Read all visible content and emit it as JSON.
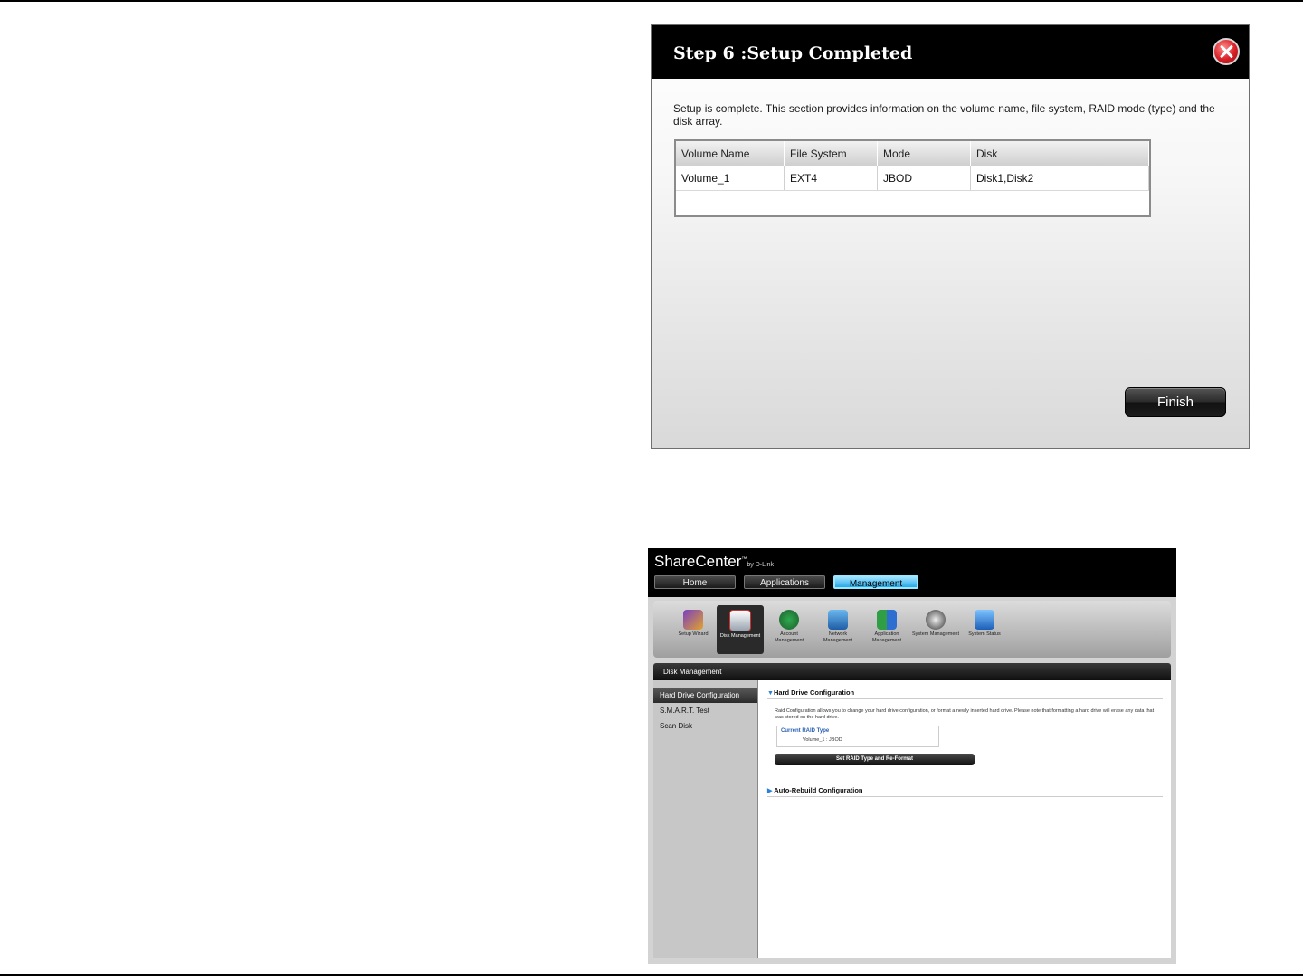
{
  "dialog": {
    "title": "Step 6 :Setup Completed",
    "description": "Setup is complete. This section provides information on the volume name, file system, RAID mode (type) and the disk array.",
    "table": {
      "headers": [
        "Volume Name",
        "File System",
        "Mode",
        "Disk"
      ],
      "rows": [
        [
          "Volume_1",
          "EXT4",
          "JBOD",
          "Disk1,Disk2"
        ]
      ]
    },
    "finish_label": "Finish"
  },
  "sharecenter": {
    "logo": "ShareCenter",
    "logo_tm": "™",
    "logo_by": "by D-Link",
    "tabs": [
      "Home",
      "Applications",
      "Management"
    ],
    "toolbar": [
      "Setup Wizard",
      "Disk Management",
      "Account Management",
      "Network Management",
      "Application Management",
      "System Management",
      "System Status"
    ],
    "panel_title": "Disk Management",
    "side_items": [
      "Hard Drive Configuration",
      "S.M.A.R.T. Test",
      "Scan Disk"
    ],
    "section1_title": "Hard Drive Configuration",
    "section1_desc": "Raid Configuration allows you to change your hard drive configuration, or format a newly inserted hard drive. Please note that formatting a hard drive will erase any data that was stored on the hard drive.",
    "raid_title": "Current RAID Type",
    "raid_value": "Volume_1 : JBOD",
    "raid_button": "Set RAID Type and Re-Format",
    "section2_title": "Auto-Rebuild Configuration"
  }
}
